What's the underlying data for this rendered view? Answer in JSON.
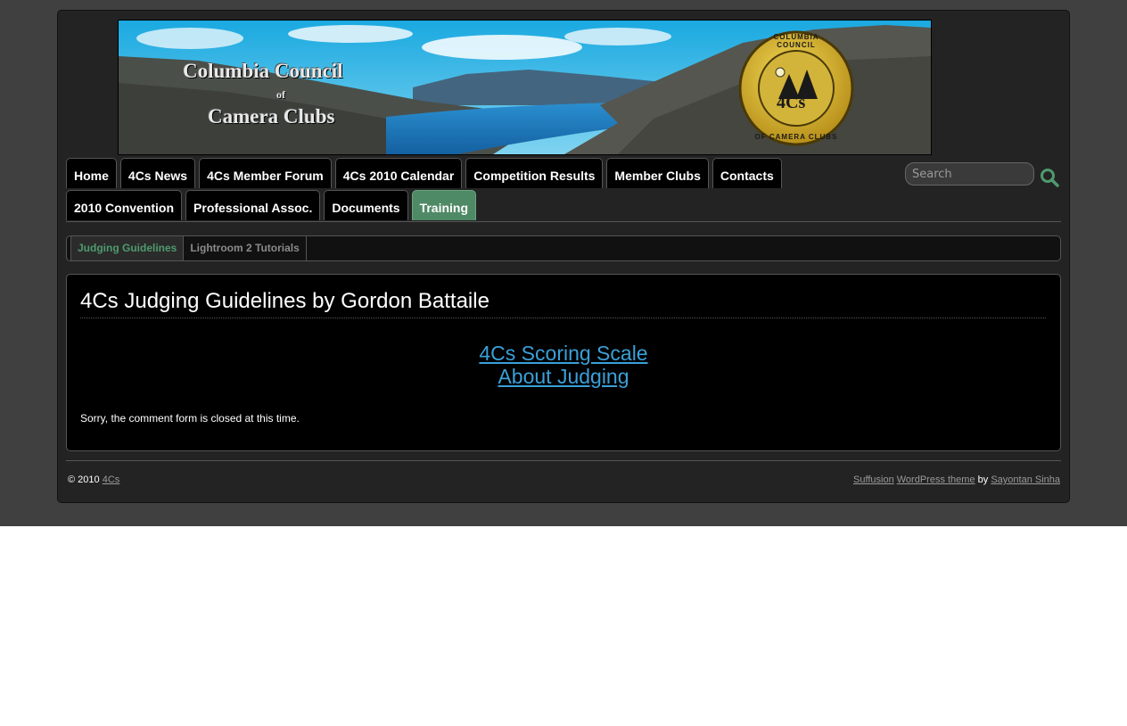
{
  "banner": {
    "title_line1": "Columbia Council",
    "title_line2": "of",
    "title_line3": "Camera Clubs",
    "logo_top_text": "COLUMBIA COUNCIL",
    "logo_bottom_text": "OF CAMERA CLUBS",
    "logo_center_text": "4Cs"
  },
  "nav": {
    "row1": [
      "Home",
      "4Cs News",
      "4Cs Member Forum",
      "4Cs 2010 Calendar",
      "Competition Results",
      "Member Clubs",
      "Contacts"
    ],
    "row2": [
      "2010 Convention",
      "Professional Assoc.",
      "Documents",
      "Training"
    ],
    "active": "Training"
  },
  "search": {
    "placeholder": "Search",
    "icon": "search-icon"
  },
  "subnav": {
    "items": [
      "Judging Guidelines",
      "Lightroom 2 Tutorials"
    ],
    "active": "Judging Guidelines"
  },
  "content": {
    "title": "4Cs Judging Guidelines by Gordon Battaile",
    "links": [
      "4Cs Scoring Scale",
      "About Judging"
    ],
    "comment_notice": "Sorry, the comment form is closed at this time."
  },
  "footer": {
    "copyright": "© 2010",
    "site_link": "4Cs",
    "theme_link": "Suffusion",
    "wp_link": "WordPress theme",
    "by": "by",
    "author_link": "Sayontan Sinha"
  },
  "colors": {
    "accent": "#4f8a66",
    "link": "#3aa0d8",
    "background": "#404040"
  }
}
